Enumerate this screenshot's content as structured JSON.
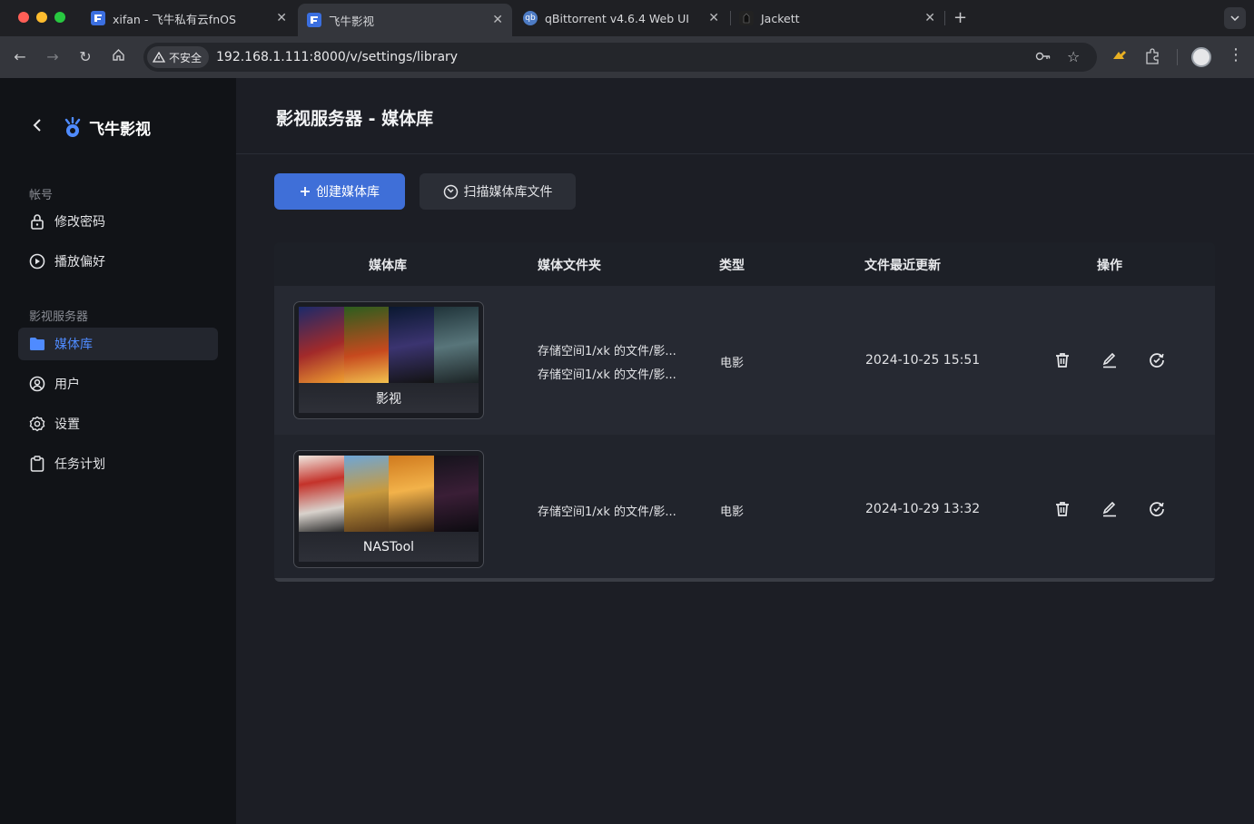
{
  "browser": {
    "tabs": [
      {
        "label": "xifan - 飞牛私有云fnOS",
        "favicon": "fnos-icon"
      },
      {
        "label": "飞牛影视",
        "favicon": "fnos-icon",
        "active": true
      },
      {
        "label": "qBittorrent v4.6.4 Web UI",
        "favicon": "qbittorrent-icon"
      },
      {
        "label": "Jackett",
        "favicon": "jackett-icon"
      }
    ],
    "security_label": "不安全",
    "url": "192.168.1.111:8000/v/settings/library"
  },
  "sidebar": {
    "brand": "飞牛影视",
    "sections": [
      {
        "title": "帐号",
        "items": [
          {
            "label": "修改密码",
            "icon": "lock-icon"
          },
          {
            "label": "播放偏好",
            "icon": "play-circle-icon"
          }
        ]
      },
      {
        "title": "影视服务器",
        "items": [
          {
            "label": "媒体库",
            "icon": "folder-icon",
            "active": true
          },
          {
            "label": "用户",
            "icon": "user-icon"
          },
          {
            "label": "设置",
            "icon": "gear-icon"
          },
          {
            "label": "任务计划",
            "icon": "clipboard-icon"
          }
        ]
      }
    ]
  },
  "main": {
    "title": "影视服务器 - 媒体库",
    "create_button": "创建媒体库",
    "scan_button": "扫描媒体库文件",
    "table": {
      "headers": [
        "媒体库",
        "媒体文件夹",
        "类型",
        "文件最近更新",
        "操作"
      ],
      "rows": [
        {
          "name": "影视",
          "folders": [
            "存储空间1/xk 的文件/影...",
            "存储空间1/xk 的文件/影..."
          ],
          "type": "电影",
          "updated": "2024-10-25 15:51"
        },
        {
          "name": "NASTool",
          "folders": [
            "存储空间1/xk 的文件/影..."
          ],
          "type": "电影",
          "updated": "2024-10-29 13:32"
        }
      ]
    }
  },
  "colors": {
    "accent": "#3f6fd8",
    "active_nav": "#4f8bff"
  }
}
